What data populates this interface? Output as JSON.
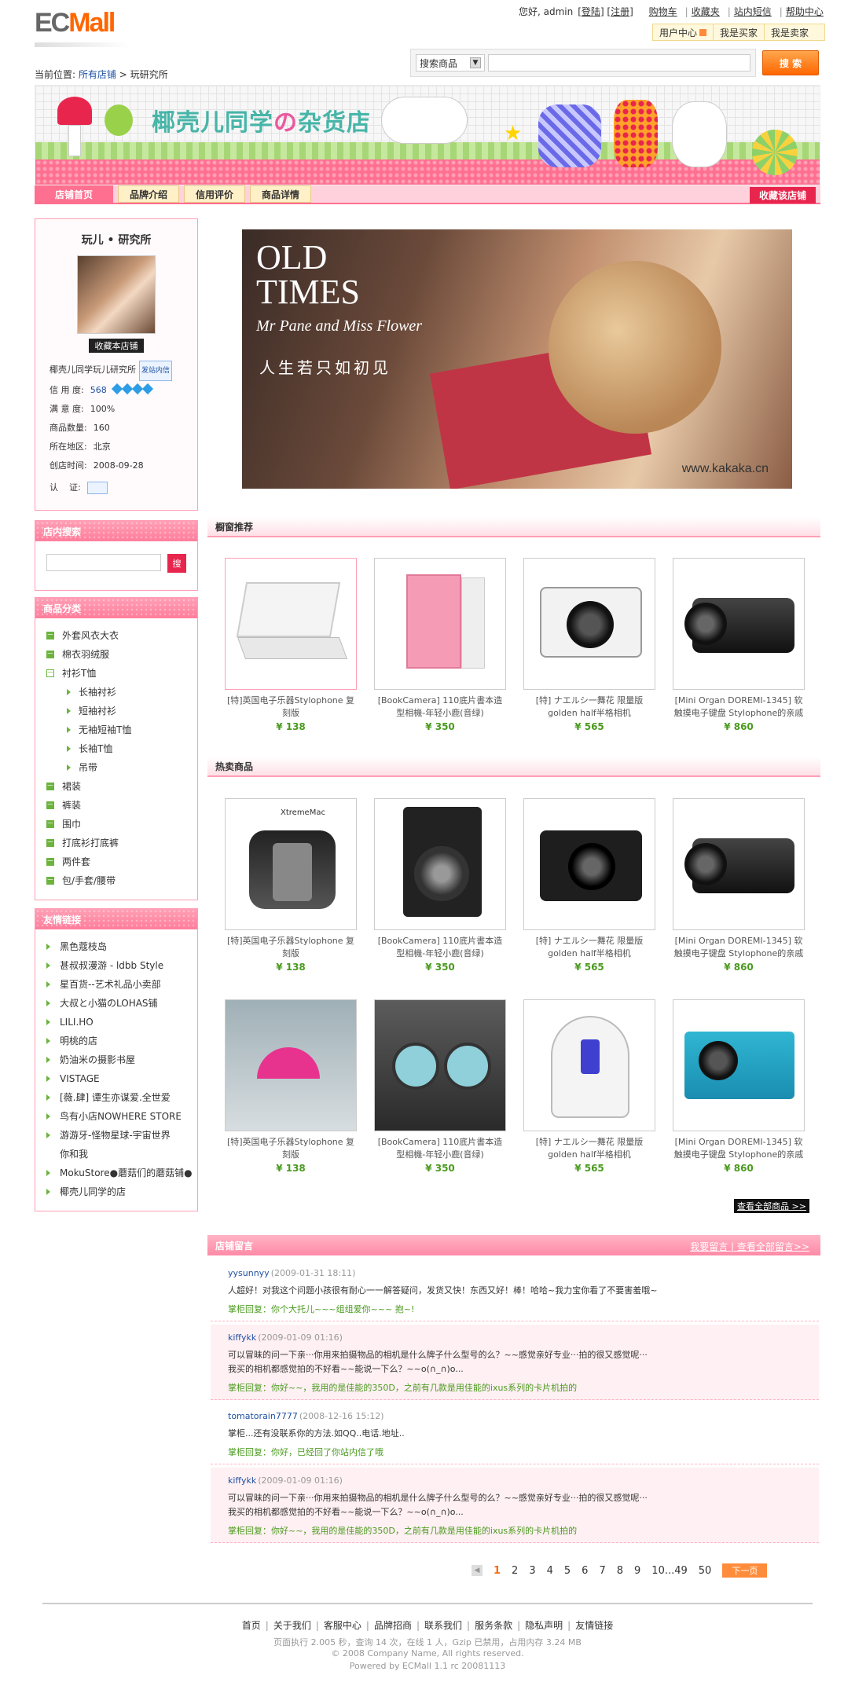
{
  "header": {
    "logo_ec": "EC",
    "logo_mall": "Mall",
    "greeting": "您好, admin",
    "logout": "登陆",
    "register": "注册",
    "links": [
      "购物车",
      "收藏夹",
      "站内短信",
      "帮助中心"
    ],
    "switch": [
      "用户中心",
      "我是买家",
      "我是卖家"
    ],
    "search_select": "搜索商品",
    "search_btn": "搜 索",
    "crumb_label": "当前位置:",
    "crumb_all": "所有店铺",
    "crumb_current": "玩研究所"
  },
  "banner": {
    "title_a": "椰壳儿同学",
    "title_b": "の",
    "title_c": "杂货店"
  },
  "nav": {
    "home": "店铺首页",
    "tabs": [
      "品牌介绍",
      "信用评价",
      "商品详情"
    ],
    "fav": "收藏该店铺"
  },
  "shop": {
    "name": "玩儿 • 研究所",
    "fav_btn": "收藏本店铺",
    "owner": "椰壳儿同学玩儿研究所",
    "owner_tag": "发站内信",
    "credit_label": "信 用 度:",
    "credit_value": "568",
    "satisfaction_label": "满 意 度:",
    "satisfaction_value": "100%",
    "goods_label": "商品数量:",
    "goods_value": "160",
    "region_label": "所在地区:",
    "region_value": "北京",
    "created_label": "创店时间:",
    "created_value": "2008-09-28",
    "cert_label": "认    证:"
  },
  "instore": {
    "title": "店内搜索",
    "btn": "搜"
  },
  "categories": {
    "title": "商品分类",
    "items": [
      {
        "label": "外套风衣大衣",
        "sub": false,
        "expanded": false
      },
      {
        "label": "棉衣羽绒服",
        "sub": false,
        "expanded": false
      },
      {
        "label": "衬衫T恤",
        "sub": false,
        "expanded": true
      },
      {
        "label": "长袖衬衫",
        "sub": true
      },
      {
        "label": "短袖衬衫",
        "sub": true
      },
      {
        "label": "无袖短袖T恤",
        "sub": true
      },
      {
        "label": "长袖T恤",
        "sub": true
      },
      {
        "label": "吊带",
        "sub": true
      },
      {
        "label": "裙装",
        "sub": false,
        "expanded": false
      },
      {
        "label": "裤装",
        "sub": false,
        "expanded": false
      },
      {
        "label": "围巾",
        "sub": false,
        "expanded": false
      },
      {
        "label": "打底衫打底裤",
        "sub": false,
        "expanded": false
      },
      {
        "label": "两件套",
        "sub": false,
        "expanded": false
      },
      {
        "label": "包/手套/腰带",
        "sub": false,
        "expanded": false
      }
    ]
  },
  "friendlinks": {
    "title": "友情链接",
    "items": [
      "黑色蔻枝岛",
      "甚叔叔漫游 - ldbb Style",
      "星百货--艺术礼品小卖部",
      "大叔と小猫のLOHAS铺",
      "LILI.HO",
      "明桃的店",
      "奶油米の摄影书屋",
      "VISTAGE",
      "[薇.肆] 谭生亦谋爱.全世爱",
      "鸟有小店NOWHERE STORE",
      "游游牙-怪物星球-宇宙世界",
      "你和我",
      "MokuStore●蘑菇们的蘑菇铺●",
      "椰壳儿同学的店"
    ]
  },
  "slide": {
    "line1": "OLD",
    "line2": "TIMES",
    "line3": "Mr Pane and Miss Flower",
    "line4": "人生若只如初见",
    "watermark": "www.kakaka.cn"
  },
  "sections": {
    "recommend": "橱窗推荐",
    "hot": "热卖商品",
    "viewall": "查看全部商品 >>"
  },
  "products": {
    "row1": [
      {
        "name": "[特]英国电子乐器Stylophone 复刻版",
        "price": "¥ 138",
        "img": "laptop-white"
      },
      {
        "name": "[BookCamera] 110底片書本造型相機-年轻小鹿(音绿)",
        "price": "¥ 350",
        "img": "laptop-pink"
      },
      {
        "name": "[特] ナエルシ一舞花 限量版 golden half半格相机",
        "price": "¥ 565",
        "img": "camera-pentax"
      },
      {
        "name": "[Mini Organ DOREMI-1345] 软触摸电子键盘 Stylophone的亲戚",
        "price": "¥ 860",
        "img": "camcorder"
      }
    ],
    "row2": [
      {
        "name": "[特]英国电子乐器Stylophone 复刻版",
        "price": "¥ 138",
        "img": "ipod-armband"
      },
      {
        "name": "[BookCamera] 110底片書本造型相機-年轻小鹿(音绿)",
        "price": "¥ 350",
        "img": "rollei-camera"
      },
      {
        "name": "[特] ナエルシ一舞花 限量版 golden half半格相机",
        "price": "¥ 565",
        "img": "canon-compact"
      },
      {
        "name": "[Mini Organ DOREMI-1345] 软触摸电子键盘 Stylophone的亲戚",
        "price": "¥ 860",
        "img": "camcorder2"
      }
    ],
    "row3": [
      {
        "name": "[特]英国电子乐器Stylophone 复刻版",
        "price": "¥ 138",
        "img": "umbrella"
      },
      {
        "name": "[BookCamera] 110底片書本造型相機-年轻小鹿(音绿)",
        "price": "¥ 350",
        "img": "headphones"
      },
      {
        "name": "[特] ナエルシ一舞花 限量版 golden half半格相机",
        "price": "¥ 565",
        "img": "ipod-speaker"
      },
      {
        "name": "[Mini Organ DOREMI-1345] 软触摸电子键盘 Stylophone的亲戚",
        "price": "¥ 860",
        "img": "sony-camera"
      }
    ],
    "xtrememac": "XtremeMac"
  },
  "messages": {
    "title": "店铺留言",
    "links": "我要留言 | 查看全部留言>>",
    "items": [
      {
        "user": "yysunnyy",
        "time": "(2009-01-31 18:11)",
        "text": "人超好！对我这个问题小孩很有耐心一一解答疑问，发货又快！东西又好！棒！哈哈~我力宝你看了不要害羞哦~",
        "reply": "掌柜回复：你个大托儿~~~组组爱你~~~ 抱~!",
        "pink": false
      },
      {
        "user": "kiffykk",
        "time": "(2009-01-09 01:16)",
        "text": "可以冒昧的问一下亲···你用来拍摄物品的相机是什么牌子什么型号的么？~~感觉亲好专业···拍的很又感觉呢···\n我买的相机都感觉拍的不好看~~能说一下么？~~o(∩_∩)o...",
        "reply": "掌柜回复：你好~~，我用的是佳能的350D，之前有几款是用佳能的ixus系列的卡片机拍的",
        "pink": true
      },
      {
        "user": "tomatorain7777",
        "time": "(2008-12-16 15:12)",
        "text": "掌柜...还有没联系你的方法.如QQ..电话.地址..",
        "reply": "掌柜回复：你好，已经回了你站内信了哦",
        "pink": false
      },
      {
        "user": "kiffykk",
        "time": "(2009-01-09 01:16)",
        "text": "可以冒昧的问一下亲···你用来拍摄物品的相机是什么牌子什么型号的么？~~感觉亲好专业···拍的很又感觉呢···\n我买的相机都感觉拍的不好看~~能说一下么？~~o(∩_∩)o...",
        "reply": "掌柜回复：你好~~，我用的是佳能的350D，之前有几款是用佳能的ixus系列的卡片机拍的",
        "pink": true
      }
    ]
  },
  "pager": {
    "prev": "◀",
    "pages": [
      "1",
      "2",
      "3",
      "4",
      "5",
      "6",
      "7",
      "8",
      "9",
      "10...49",
      "50"
    ],
    "current": "1",
    "next": "下一页"
  },
  "footer": {
    "links": [
      "首页",
      "关于我们",
      "客服中心",
      "品牌招商",
      "联系我们",
      "服务条款",
      "隐私声明",
      "友情链接"
    ],
    "stats": "页面执行 2.005 秒，查询 14 次，在线 1 人，Gzip 已禁用，占用内存 3.24 MB",
    "copyright": "© 2008 Company Name, All rights reserved.",
    "powered": "Powered by ECMall 1.1 rc 20081113"
  },
  "colors": {
    "brand": "#ff6600",
    "pink": "#ff8aa7",
    "green": "#4a9a1e",
    "link": "#1e50a2"
  }
}
